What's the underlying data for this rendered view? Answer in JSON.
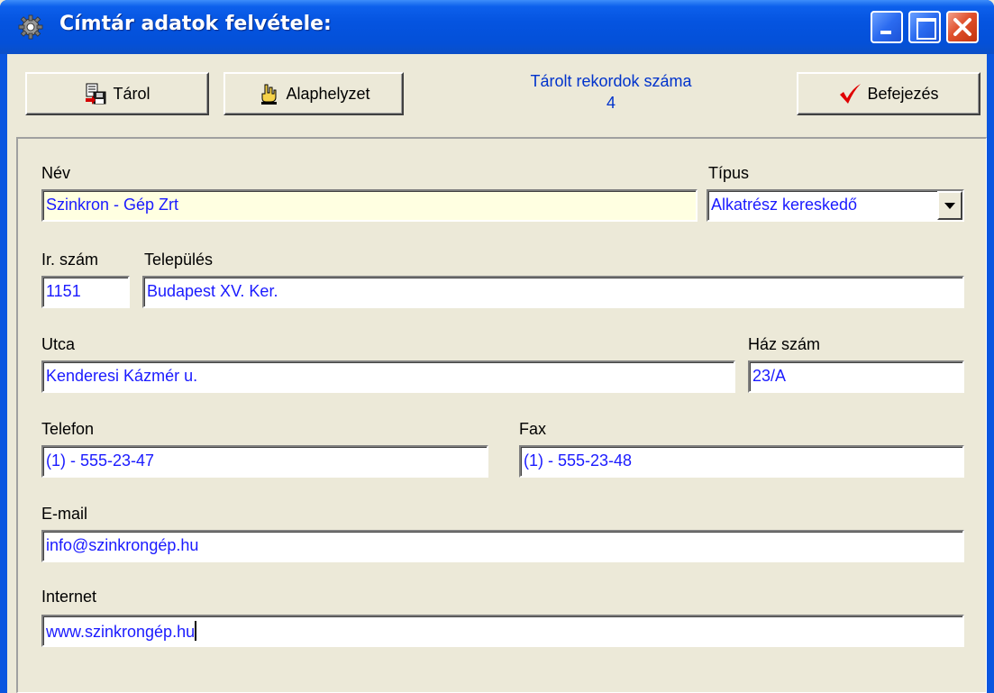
{
  "window": {
    "title": "Címtár adatok felvétele:",
    "icon": "gear-icon"
  },
  "toolbar": {
    "save_label": "Tárol",
    "save_icon": "save-disk-icon",
    "reset_label": "Alaphelyzet",
    "reset_icon": "reset-hand-icon",
    "finish_label": "Befejezés",
    "finish_icon": "checkmark-icon",
    "counter_label": "Tárolt rekordok száma",
    "counter_value": "4"
  },
  "form": {
    "name_label": "Név",
    "name_value": "Szinkron - Gép Zrt",
    "type_label": "Típus",
    "type_value": "Alkatrész kereskedő",
    "zip_label": "Ir. szám",
    "zip_value": "1151",
    "city_label": "Település",
    "city_value": "Budapest XV. Ker.",
    "street_label": "Utca",
    "street_value": "Kenderesi Kázmér u.",
    "house_label": "Ház szám",
    "house_value": "23/A",
    "phone_label": "Telefon",
    "phone_value": "(1) - 555-23-47",
    "fax_label": "Fax",
    "fax_value": "(1) - 555-23-48",
    "email_label": "E-mail",
    "email_value": "info@szinkrongép.hu",
    "web_label": "Internet",
    "web_value": "www.szinkrongép.hu"
  },
  "colors": {
    "titlebar": "#0554e0",
    "field_text": "#1a1aff",
    "counter_text": "#0033cc",
    "highlight_field": "#ffffe1",
    "checkmark": "#e00000"
  }
}
